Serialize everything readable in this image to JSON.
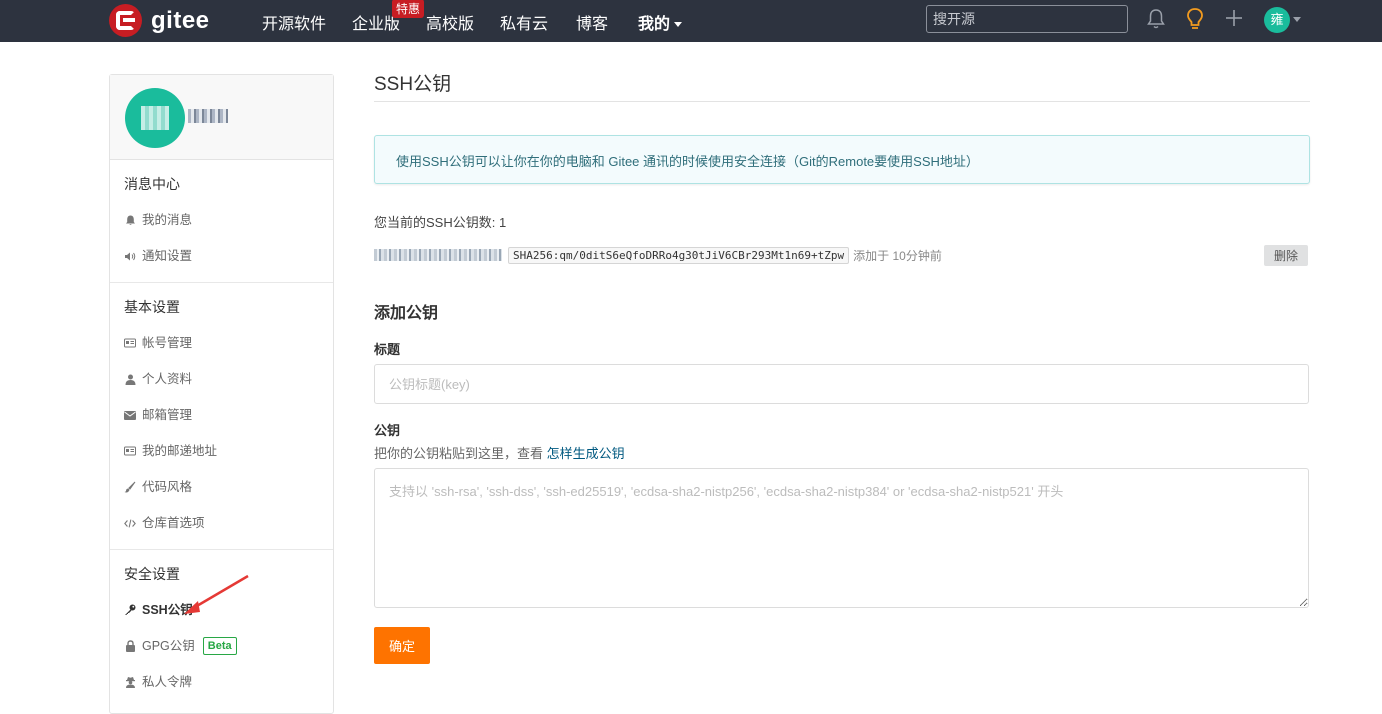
{
  "topbar": {
    "logo_text": "gitee",
    "nav": [
      {
        "label": "开源软件"
      },
      {
        "label": "企业版"
      },
      {
        "label": "高校版"
      },
      {
        "label": "私有云"
      },
      {
        "label": "博客"
      },
      {
        "label": "我的"
      }
    ],
    "hot_badge": "特惠",
    "search_placeholder": "搜开源",
    "avatar_text": "雍"
  },
  "sidebar": {
    "sections": [
      {
        "title": "消息中心",
        "items": [
          {
            "label": "我的消息",
            "icon": "bell-icon"
          },
          {
            "label": "通知设置",
            "icon": "speaker-icon"
          }
        ]
      },
      {
        "title": "基本设置",
        "items": [
          {
            "label": "帐号管理",
            "icon": "id-card-icon"
          },
          {
            "label": "个人资料",
            "icon": "user-icon"
          },
          {
            "label": "邮箱管理",
            "icon": "envelope-icon"
          },
          {
            "label": "我的邮递地址",
            "icon": "address-card-icon"
          },
          {
            "label": "代码风格",
            "icon": "brush-icon"
          },
          {
            "label": "仓库首选项",
            "icon": "code-icon"
          }
        ]
      },
      {
        "title": "安全设置",
        "items": [
          {
            "label": "SSH公钥",
            "icon": "key-icon",
            "active": true
          },
          {
            "label": "GPG公钥",
            "icon": "lock-icon",
            "badge": "Beta"
          },
          {
            "label": "私人令牌",
            "icon": "user-secret-icon"
          }
        ]
      }
    ]
  },
  "main": {
    "title": "SSH公钥",
    "info": "使用SSH公钥可以让你在你的电脑和 Gitee 通讯的时候使用安全连接（Git的Remote要使用SSH地址）",
    "key_count_label": "您当前的SSH公钥数: 1",
    "key": {
      "fingerprint": "SHA256:qm/0ditS6eQfoDRRo4g30tJiV6CBr293Mt1n69+tZpw",
      "added": "添加于 10分钟前",
      "delete_label": "删除"
    },
    "add_title": "添加公钥",
    "title_label": "标题",
    "title_placeholder": "公钥标题(key)",
    "key_label": "公钥",
    "key_hint": "把你的公钥粘贴到这里，查看",
    "key_hint_link": "怎样生成公钥",
    "key_placeholder": "支持以 'ssh-rsa', 'ssh-dss', 'ssh-ed25519', 'ecdsa-sha2-nistp256', 'ecdsa-sha2-nistp384' or 'ecdsa-sha2-nistp521' 开头",
    "submit_label": "确定"
  },
  "colors": {
    "topbar_bg": "#2d333f",
    "brand_red": "#c71d23",
    "accent_orange": "#fe7300",
    "avatar_green": "#1abc9c",
    "info_bg": "#f3fbfd",
    "annotation_arrow": "#e53935"
  }
}
